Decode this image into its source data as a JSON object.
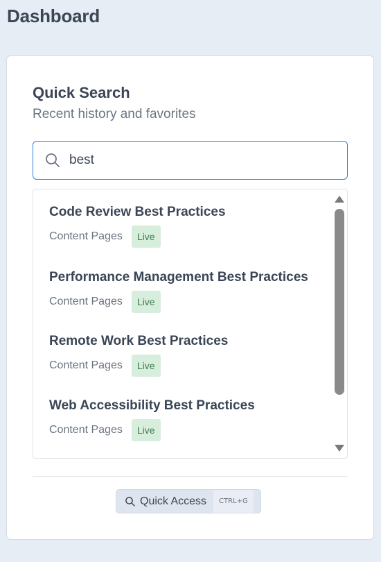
{
  "page": {
    "title": "Dashboard"
  },
  "card": {
    "title": "Quick Search",
    "subtitle": "Recent history and favorites"
  },
  "search": {
    "value": "best",
    "icon": "search-icon"
  },
  "results": [
    {
      "title": "Code Review Best Practices",
      "type": "Content Pages",
      "status": "Live"
    },
    {
      "title": "Performance Management Best Practices",
      "type": "Content Pages",
      "status": "Live"
    },
    {
      "title": "Remote Work Best Practices",
      "type": "Content Pages",
      "status": "Live"
    },
    {
      "title": "Web Accessibility Best Practices",
      "type": "Content Pages",
      "status": "Live"
    }
  ],
  "quick_access": {
    "label": "Quick Access",
    "shortcut": "CTRL+G",
    "icon": "search-icon"
  },
  "colors": {
    "background": "#e6edf5",
    "accent": "#2f7fd1",
    "badge_bg": "#d8eedd",
    "badge_text": "#3d7d4e"
  }
}
